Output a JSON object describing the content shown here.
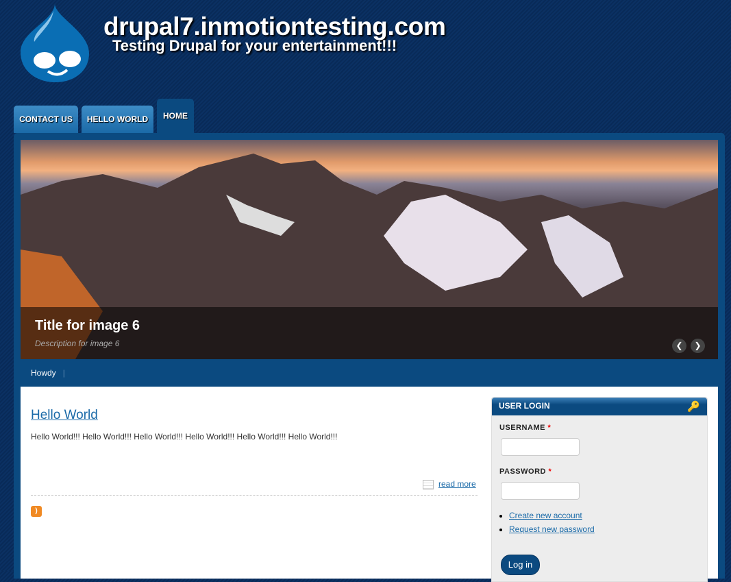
{
  "site": {
    "name": "drupal7.inmotiontesting.com",
    "slogan": "Testing Drupal for your entertainment!!!"
  },
  "nav": {
    "tabs": [
      {
        "label": "CONTACT US"
      },
      {
        "label": "HELLO WORLD"
      },
      {
        "label": "HOME"
      }
    ]
  },
  "slideshow": {
    "title": "Title for image 6",
    "description": "Description for image 6",
    "prev": "❮",
    "next": "❯"
  },
  "secondary_nav": {
    "items": [
      "Howdy"
    ],
    "separator": "|"
  },
  "node": {
    "title": "Hello World",
    "body": "Hello World!!! Hello World!!! Hello World!!! Hello World!!! Hello World!!! Hello World!!!",
    "read_more": "read more"
  },
  "login": {
    "title": "USER LOGIN",
    "username_label": "USERNAME",
    "password_label": "PASSWORD",
    "required": "*",
    "create_account": "Create new account",
    "request_password": "Request new password",
    "submit": "Log in"
  },
  "icons": {
    "rss": "rss-icon",
    "key": "key-icon"
  }
}
